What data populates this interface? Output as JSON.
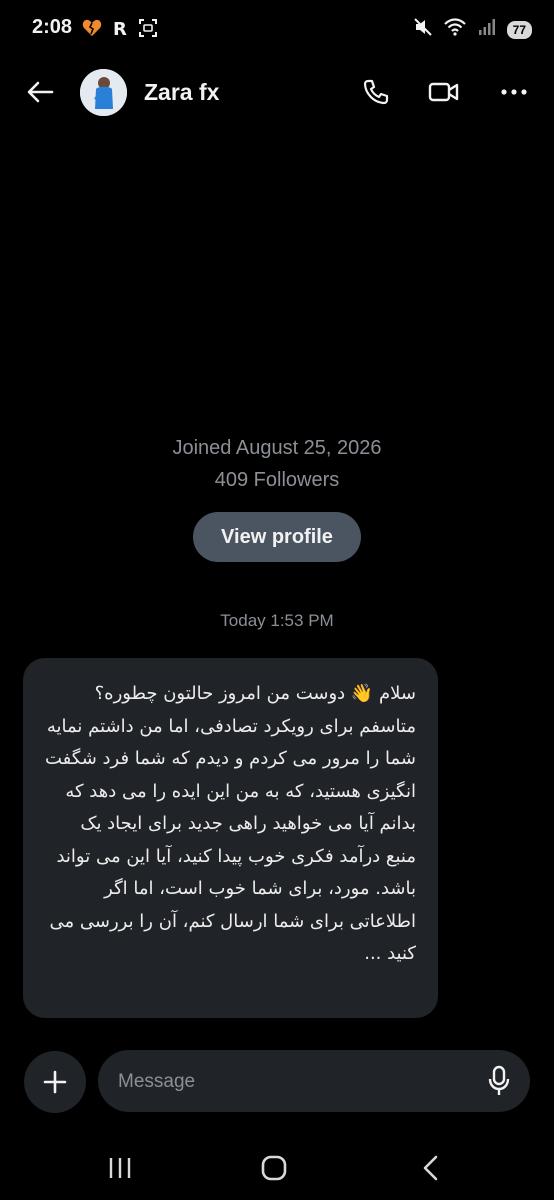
{
  "status_bar": {
    "time": "2:08",
    "battery": "77",
    "left_icons": [
      "heart-broken-icon",
      "r-app-icon",
      "screenshot-icon"
    ],
    "right_icons": [
      "mute-icon",
      "wifi-icon",
      "signal-icon",
      "battery-icon"
    ]
  },
  "header": {
    "contact_name": "Zara fx",
    "back_icon": "arrow-left-icon",
    "actions": [
      "phone-icon",
      "video-icon",
      "more-icon"
    ]
  },
  "profile": {
    "joined": "Joined August 25, 2026",
    "followers": "409 Followers",
    "view_profile_label": "View profile"
  },
  "conversation": {
    "timestamp": "Today 1:53 PM",
    "messages": [
      {
        "direction": "incoming",
        "text": "سلام 👋 دوست من امروز حالتون چطوره؟ متاسفم برای رویکرد تصادفی، اما من داشتم نمایه شما را مرور می کردم و دیدم که شما فرد شگفت انگیزی هستید، که به من این ایده را می دهد که بدانم آیا می خواهید راهی جدید برای ایجاد یک منبع درآمد فکری خوب پیدا کنید، آیا این می تواند باشد.  مورد، برای شما خوب است، اما اگر اطلاعاتی برای شما ارسال کنم، آن را بررسی می کنید ..."
      }
    ]
  },
  "composer": {
    "placeholder": "Message",
    "value": ""
  },
  "nav_bar": {
    "buttons": [
      "recents-icon",
      "home-icon",
      "back-nav-icon"
    ]
  },
  "colors": {
    "background": "#000000",
    "bubble": "#202327",
    "button": "#4a5561",
    "muted_text": "#8b9096"
  }
}
